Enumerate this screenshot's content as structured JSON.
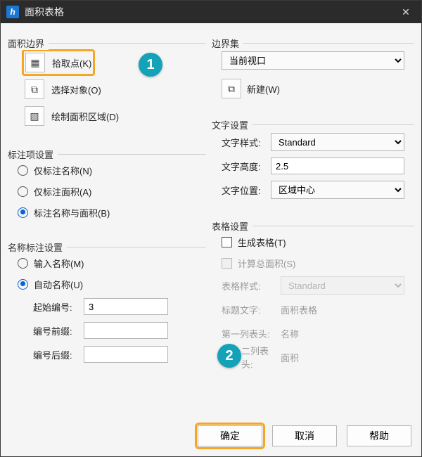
{
  "window": {
    "title": "面积表格",
    "app_icon_letter": "h"
  },
  "left": {
    "boundary": {
      "title": "面积边界",
      "pick_point": "拾取点(K)",
      "select_object": "选择对象(O)",
      "draw_region": "绘制面积区域(D)"
    },
    "annotation_item": {
      "title": "标注项设置",
      "only_name": "仅标注名称(N)",
      "only_area": "仅标注面积(A)",
      "name_and_area": "标注名称与面积(B)"
    },
    "name_setting": {
      "title": "名称标注设置",
      "input_name": "输入名称(M)",
      "auto_name": "自动名称(U)",
      "start_number_label": "起始编号:",
      "start_number_value": "3",
      "prefix_label": "编号前缀:",
      "prefix_value": "",
      "suffix_label": "编号后缀:",
      "suffix_value": ""
    }
  },
  "right": {
    "boundary_set": {
      "title": "边界集",
      "current_viewport": "当前视口",
      "new_button": "新建(W)"
    },
    "text_setting": {
      "title": "文字设置",
      "style_label": "文字样式:",
      "style_value": "Standard",
      "height_label": "文字高度:",
      "height_value": "2.5",
      "position_label": "文字位置:",
      "position_value": "区域中心"
    },
    "table_setting": {
      "title": "表格设置",
      "generate_table": "生成表格(T)",
      "calc_total": "计算总面积(S)",
      "table_style_label": "表格样式:",
      "table_style_value": "Standard",
      "title_text_label": "标题文字:",
      "title_text_value": "面积表格",
      "col1_header_label": "第一列表头:",
      "col1_header_value": "名称",
      "col2_header_label": "二列表头:",
      "col2_header_value": "面积"
    }
  },
  "footer": {
    "ok": "确定",
    "cancel": "取消",
    "help": "帮助"
  },
  "callouts": {
    "one": "1",
    "two": "2"
  }
}
